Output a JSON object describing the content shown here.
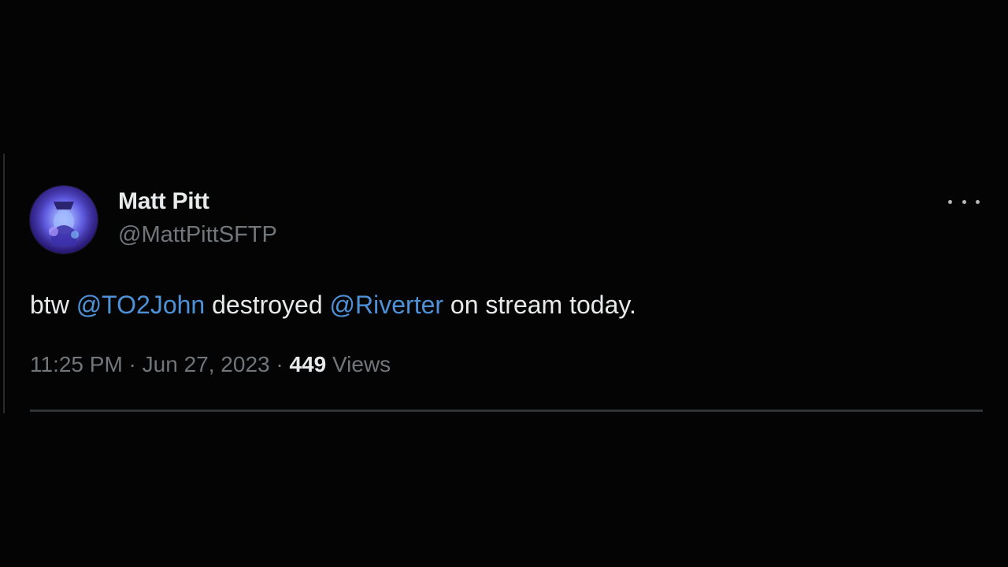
{
  "tweet": {
    "author": {
      "display_name": "Matt Pitt",
      "handle": "@MattPittSFTP"
    },
    "more_icon": "more-horizontal-icon",
    "text": {
      "prefix": "btw ",
      "mention_1": "@TO2John",
      "middle": " destroyed ",
      "mention_2": "@Riverter",
      "suffix": " on stream today."
    },
    "meta": {
      "time": "11:25 PM",
      "separator": " · ",
      "date": "Jun 27, 2023",
      "views_count": "449",
      "views_label": " Views"
    }
  },
  "colors": {
    "background": "#040404",
    "text_primary": "#e7e9ea",
    "text_secondary": "#71767b",
    "mention": "#4e91d6",
    "divider": "#2f3336"
  }
}
